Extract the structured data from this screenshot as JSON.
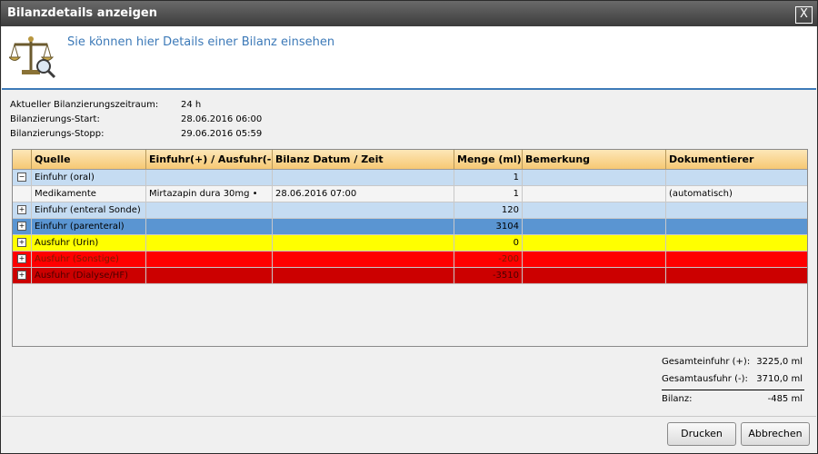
{
  "window": {
    "title": "Bilanzdetails anzeigen",
    "close_label": "X"
  },
  "header": {
    "subtitle": "Sie können hier Details einer Bilanz einsehen"
  },
  "info": [
    {
      "label": "Aktueller Bilanzierungszeitraum:",
      "value": "24 h"
    },
    {
      "label": "Bilanzierungs-Start:",
      "value": "28.06.2016 06:00"
    },
    {
      "label": "Bilanzierungs-Stopp:",
      "value": "29.06.2016 05:59"
    }
  ],
  "table": {
    "columns": [
      "Quelle",
      "Einfuhr(+) / Ausfuhr(-)",
      "Bilanz Datum / Zeit",
      "Menge (ml)",
      "Bemerkung",
      "Dokumentierer"
    ],
    "rows": [
      {
        "expander": "−",
        "quelle": "Einfuhr (oral)",
        "art": "",
        "datum": "",
        "menge": "1",
        "bemerkung": "",
        "dokumentierer": "",
        "color": "#c5dcf2",
        "text_color": "#000000"
      },
      {
        "expander": "",
        "quelle": "Medikamente",
        "art": "Mirtazapin dura 30mg •",
        "datum": "28.06.2016 07:00",
        "menge": "1",
        "bemerkung": "",
        "dokumentierer": "(automatisch)",
        "color": "#f4f4f4",
        "text_color": "#000000"
      },
      {
        "expander": "+",
        "quelle": "Einfuhr (enteral Sonde)",
        "art": "",
        "datum": "",
        "menge": "120",
        "bemerkung": "",
        "dokumentierer": "",
        "color": "#c5dcf2",
        "text_color": "#000000"
      },
      {
        "expander": "+",
        "quelle": "Einfuhr (parenteral)",
        "art": "",
        "datum": "",
        "menge": "3104",
        "bemerkung": "",
        "dokumentierer": "",
        "color": "#5a95d2",
        "text_color": "#000000"
      },
      {
        "expander": "+",
        "quelle": "Ausfuhr (Urin)",
        "art": "",
        "datum": "",
        "menge": "0",
        "bemerkung": "",
        "dokumentierer": "",
        "color": "#ffff00",
        "text_color": "#000000"
      },
      {
        "expander": "+",
        "quelle": "Ausfuhr (Sonstige)",
        "art": "",
        "datum": "",
        "menge": "-200",
        "bemerkung": "",
        "dokumentierer": "",
        "color": "#ff0000",
        "text_color": "#7a1a00"
      },
      {
        "expander": "+",
        "quelle": "Ausfuhr (Dialyse/HF)",
        "art": "",
        "datum": "",
        "menge": "-3510",
        "bemerkung": "",
        "dokumentierer": "",
        "color": "#cc0000",
        "text_color": "#4a0000"
      }
    ]
  },
  "totals": [
    {
      "label": "Gesamteinfuhr (+):",
      "value": "3225,0 ml"
    },
    {
      "label": "Gesamtausfuhr (-):",
      "value": "3710,0 ml"
    },
    {
      "label": "Bilanz:",
      "value": "-485 ml"
    }
  ],
  "buttons": {
    "print": "Drucken",
    "cancel": "Abbrechen"
  }
}
